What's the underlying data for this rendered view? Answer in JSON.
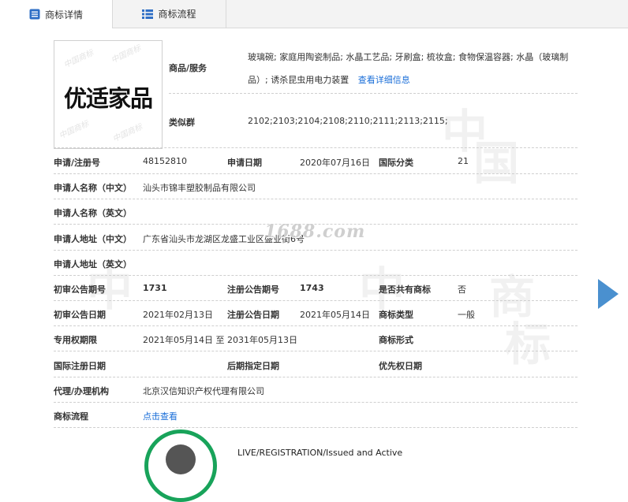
{
  "tabs": [
    {
      "label": "商标详情",
      "icon": "document-list-icon"
    },
    {
      "label": "商标流程",
      "icon": "list-icon"
    }
  ],
  "watermark": "1688.com",
  "logo": {
    "text": "优适家品"
  },
  "goods": {
    "label": "商品/服务",
    "text": "玻璃碗; 家庭用陶瓷制品; 水晶工艺品; 牙刷盒; 梳妆盒; 食物保温容器; 水晶（玻璃制品）; 诱杀昆虫用电力装置",
    "link": "查看详细信息"
  },
  "similar": {
    "label": "类似群",
    "value": "2102;2103;2104;2108;2110;2111;2113;2115;"
  },
  "fields": {
    "reg_no_label": "申请/注册号",
    "reg_no": "48152810",
    "apply_date_label": "申请日期",
    "apply_date": "2020年07月16日",
    "intl_class_label": "国际分类",
    "intl_class": "21",
    "applicant_cn_label": "申请人名称（中文）",
    "applicant_cn": "汕头市锦丰塑胶制品有限公司",
    "applicant_en_label": "申请人名称（英文）",
    "applicant_en": "",
    "address_cn_label": "申请人地址（中文）",
    "address_cn": "广东省汕头市龙湖区龙盛工业区盛业街6号",
    "address_en_label": "申请人地址（英文）",
    "address_en": "",
    "prelim_no_label": "初审公告期号",
    "prelim_no": "1731",
    "reg_pub_no_label": "注册公告期号",
    "reg_pub_no": "1743",
    "shared_label": "是否共有商标",
    "shared": "否",
    "prelim_date_label": "初审公告日期",
    "prelim_date": "2021年02月13日",
    "reg_pub_date_label": "注册公告日期",
    "reg_pub_date": "2021年05月14日",
    "tm_type_label": "商标类型",
    "tm_type": "一般",
    "exclusive_label": "专用权期限",
    "exclusive": "2021年05月14日 至 2031年05月13日",
    "tm_form_label": "商标形式",
    "tm_form": "",
    "intl_reg_date_label": "国际注册日期",
    "intl_reg_date": "",
    "later_date_label": "后期指定日期",
    "later_date": "",
    "priority_date_label": "优先权日期",
    "priority_date": "",
    "agent_label": "代理/办理机构",
    "agent": "北京汉信知识产权代理有限公司",
    "process_label": "商标流程",
    "process_link": "点击查看"
  },
  "status": {
    "text": "LIVE/REGISTRATION/Issued and Active"
  },
  "colors": {
    "link": "#1a6ed8",
    "accent": "#4a90cf",
    "status_green": "#18a35a"
  }
}
